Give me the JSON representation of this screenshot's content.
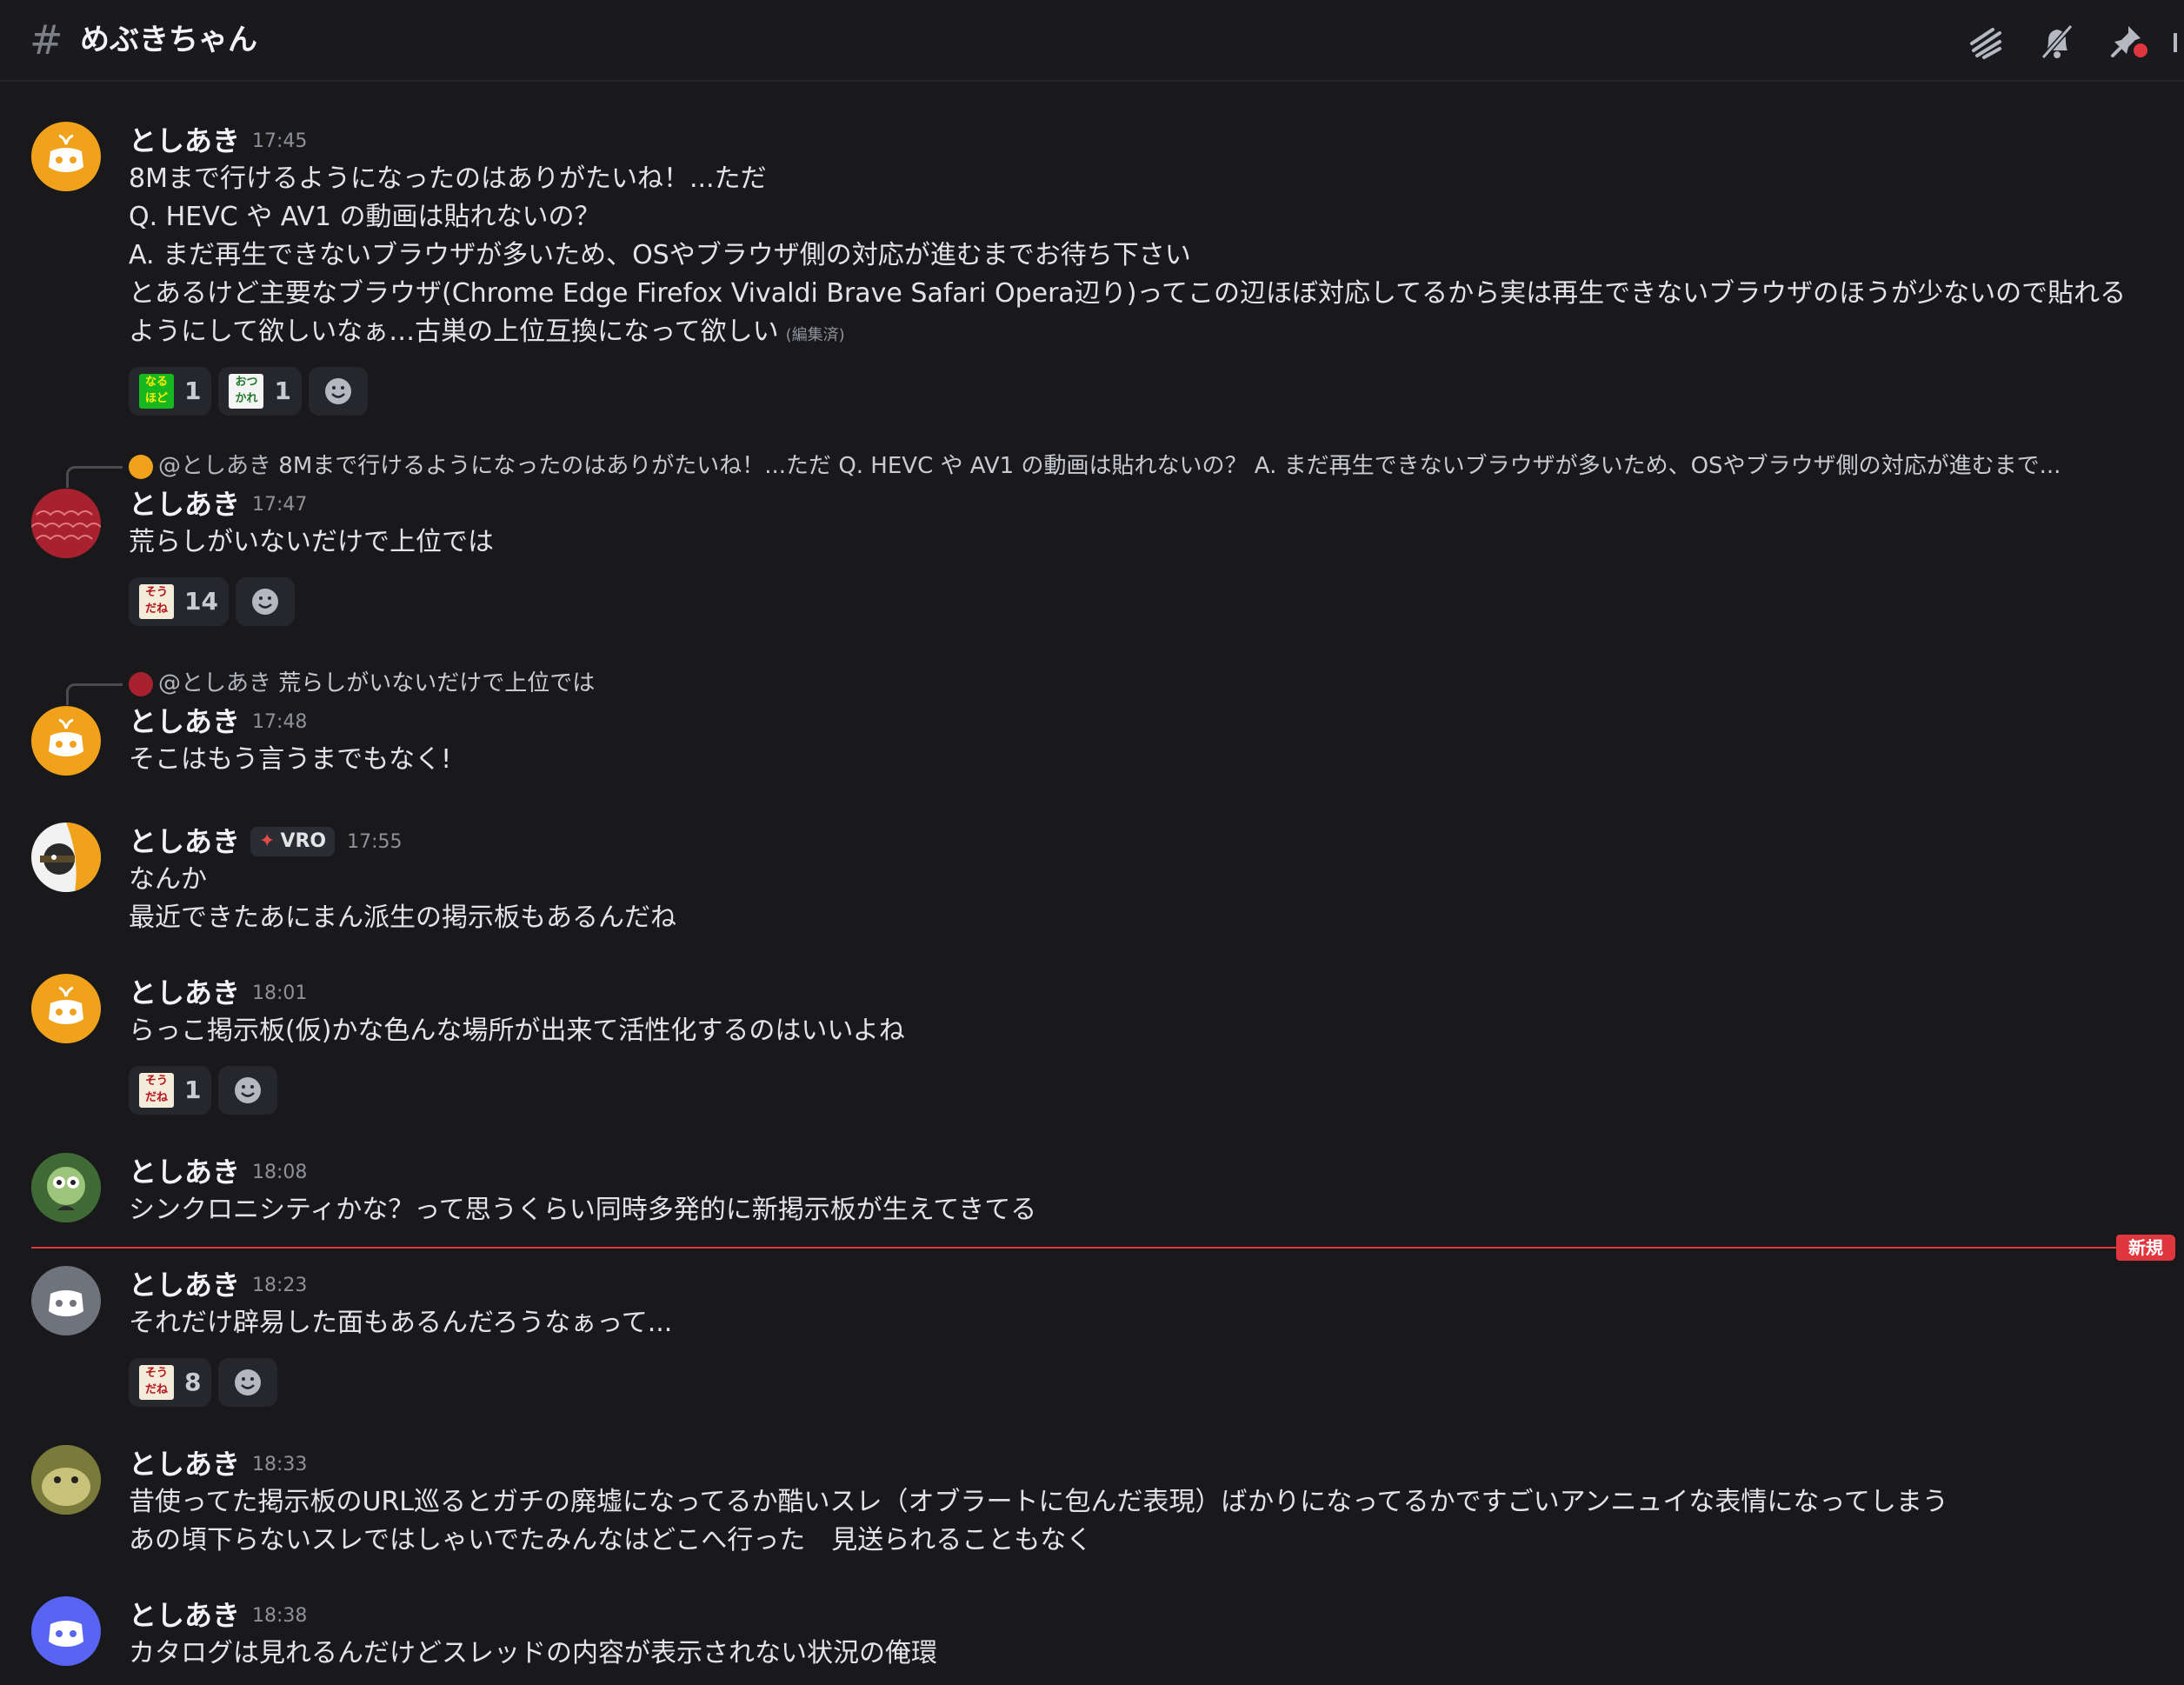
{
  "channel": {
    "hash": "#",
    "name": "めぶきちゃん"
  },
  "toolbar": {
    "icons": [
      "threads-icon",
      "mute-bell-icon",
      "pin-icon"
    ]
  },
  "colors": {
    "background": "#19191c",
    "new_divider": "#e0363e",
    "orange_avatar": "#f0a21b",
    "blurple_avatar": "#5865f2"
  },
  "messages": [
    {
      "username": "としあき",
      "time": "17:45",
      "lines": [
        "8Mまで行けるようになったのはありがたいね！...ただ",
        "Q. HEVC や AV1 の動画は貼れないの？",
        "A. まだ再生できないブラウザが多いため、OSやブラウザ側の対応が進むまでお待ち下さい",
        "とあるけど主要なブラウザ(Chrome Edge Firefox Vivaldi Brave Safari Opera辺り)ってこの辺ほぼ対応してるから実は再生できないブラウザのほうが少ないので貼れる",
        "ようにして欲しいなぁ…古巣の上位互換になって欲しい"
      ],
      "edited": "(編集済)",
      "reactions": [
        {
          "emoji": "naruhodo",
          "glyph": "なる ほど",
          "count": "1"
        },
        {
          "emoji": "otsukare",
          "glyph": "おつ かれ",
          "count": "1"
        }
      ]
    },
    {
      "reply": {
        "mention": "@としあき",
        "text": "8Mまで行けるようになったのはありがたいね！...ただ Q. HEVC や AV1 の動画は貼れないの？ A. まだ再生できないブラウザが多いため、OSやブラウザ側の対応が進むまで..."
      },
      "username": "としあき",
      "time": "17:47",
      "lines": [
        "荒らしがいないだけで上位では"
      ],
      "reactions": [
        {
          "emoji": "soudane",
          "glyph": "そう だね",
          "count": "14"
        }
      ]
    },
    {
      "reply": {
        "mention": "@としあき",
        "text": "荒らしがいないだけで上位では"
      },
      "username": "としあき",
      "time": "17:48",
      "lines": [
        "そこはもう言うまでもなく!"
      ]
    },
    {
      "username": "としあき",
      "tag": "VRO",
      "time": "17:55",
      "lines": [
        "なんか",
        "最近できたあにまん派生の掲示板もあるんだね"
      ]
    },
    {
      "username": "としあき",
      "time": "18:01",
      "lines": [
        "らっこ掲示板(仮)かな色んな場所が出来て活性化するのはいいよね"
      ],
      "reactions": [
        {
          "emoji": "soudane",
          "glyph": "そう だね",
          "count": "1"
        }
      ]
    },
    {
      "username": "としあき",
      "time": "18:08",
      "lines": [
        "シンクロニシティかな？って思うくらい同時多発的に新掲示板が生えてきてる"
      ]
    },
    {
      "new_label": "新規"
    },
    {
      "username": "としあき",
      "time": "18:23",
      "lines": [
        "それだけ辟易した面もあるんだろうなぁって..."
      ],
      "reactions": [
        {
          "emoji": "soudane",
          "glyph": "そう だね",
          "count": "8"
        }
      ]
    },
    {
      "username": "としあき",
      "time": "18:33",
      "lines": [
        "昔使ってた掲示板のURL巡るとガチの廃墟になってるか酷いスレ（オブラートに包んだ表現）ばかりになってるかですごいアンニュイな表情になってしまう",
        "あの頃下らないスレではしゃいでたみんなはどこへ行った　見送られることもなく"
      ]
    },
    {
      "username": "としあき",
      "time": "18:38",
      "lines": [
        "カタログは見れるんだけどスレッドの内容が表示されない状況の俺環"
      ]
    }
  ]
}
